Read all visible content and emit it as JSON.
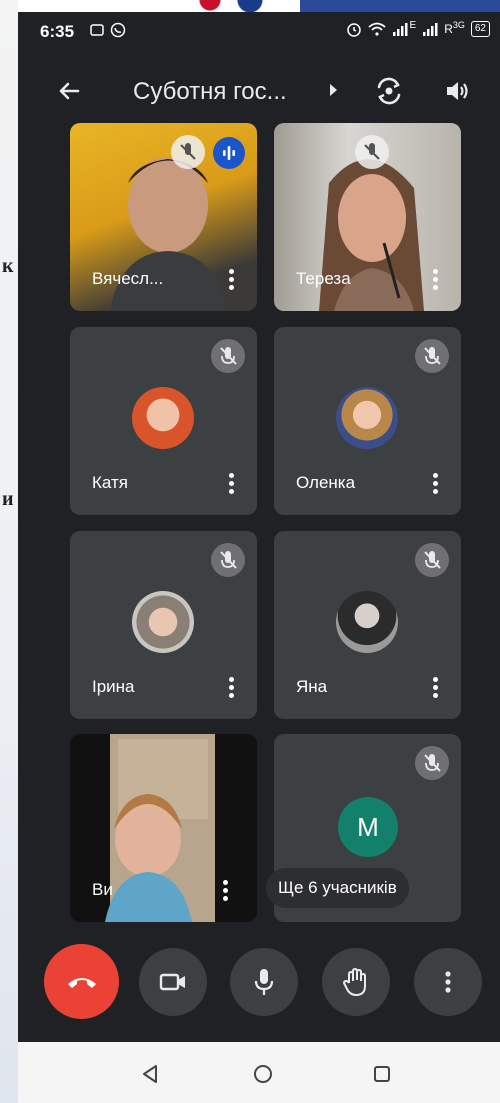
{
  "status_bar": {
    "time": "6:35",
    "left_icons": [
      "cast-icon",
      "whatsapp-icon"
    ],
    "right_icons": [
      "alarm-icon",
      "wifi-icon",
      "signal-icon",
      "signal-roaming-icon"
    ],
    "network_labels": [
      "E",
      "R",
      "3G"
    ],
    "battery": "62"
  },
  "header": {
    "title": "Суботня гос...",
    "icons": [
      "back-arrow-icon",
      "caret-right-icon",
      "switch-camera-icon",
      "speaker-icon"
    ]
  },
  "participants": [
    {
      "name": "Вячесл...",
      "state": "video",
      "speaking": true,
      "muted_badge": true
    },
    {
      "name": "Тереза",
      "state": "video",
      "speaking": false,
      "muted_badge": true
    },
    {
      "name": "Катя",
      "state": "avatar",
      "muted": true
    },
    {
      "name": "Оленка",
      "state": "avatar",
      "muted": true
    },
    {
      "name": "Ірина",
      "state": "avatar",
      "muted": true
    },
    {
      "name": "Яна",
      "state": "avatar",
      "muted": true
    },
    {
      "name": "Ви",
      "state": "video",
      "muted": false
    },
    {
      "name": "",
      "initial": "М",
      "state": "letter-avatar",
      "muted": true
    }
  ],
  "more_participants": "Ще 6 учасників",
  "controls": [
    {
      "name": "end-call",
      "icon": "phone-hangup-icon",
      "color": "#ea4335"
    },
    {
      "name": "camera",
      "icon": "video-camera-icon"
    },
    {
      "name": "microphone",
      "icon": "microphone-icon"
    },
    {
      "name": "raise-hand",
      "icon": "hand-icon"
    },
    {
      "name": "more-options",
      "icon": "more-vert-icon"
    }
  ],
  "colors": {
    "background": "#202124",
    "tile": "#3c4043",
    "end_call": "#ea4335",
    "speaking": "#1a56c9",
    "letter_avatar": "#12806b"
  },
  "page_fragments": [
    "к",
    "и"
  ]
}
